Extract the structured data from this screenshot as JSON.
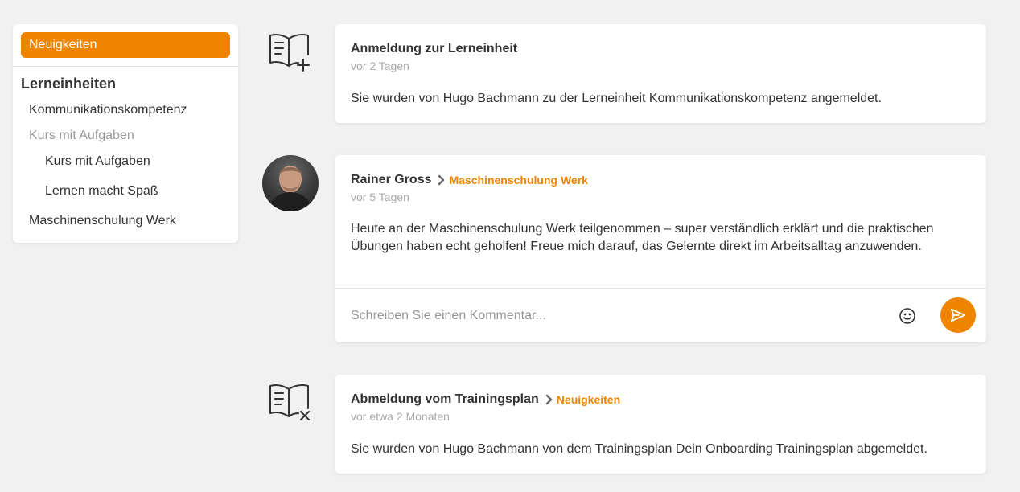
{
  "sidebar": {
    "active_label": "Neuigkeiten",
    "heading": "Lerneinheiten",
    "items": [
      {
        "label": "Kommunikationskompetenz"
      },
      {
        "label": "Kurs mit Aufgaben"
      },
      {
        "label": "Kurs mit Aufgaben"
      },
      {
        "label": "Lernen macht Spaß"
      },
      {
        "label": "Maschinenschulung Werk"
      }
    ]
  },
  "feed": [
    {
      "icon": "book-plus-icon",
      "title": "Anmeldung zur Lerneinheit",
      "time": "vor 2 Tagen",
      "body": "Sie wurden von Hugo Bachmann zu der Lerneinheit Kommunikationskompetenz angemeldet."
    },
    {
      "icon": "avatar",
      "author": "Rainer Gross",
      "breadcrumb": "Maschinenschulung Werk",
      "time": "vor 5 Tagen",
      "body": "Heute an der Maschinenschulung Werk teilgenommen – super verständlich erklärt und die praktischen Übungen haben echt geholfen! Freue mich darauf, das Gelernte direkt im Arbeitsalltag anzuwenden.",
      "comment_placeholder": "Schreiben Sie einen Kommentar..."
    },
    {
      "icon": "book-x-icon",
      "title": "Abmeldung vom Trainingsplan",
      "breadcrumb": "Neuigkeiten",
      "time": "vor etwa 2 Monaten",
      "body": "Sie wurden von Hugo Bachmann von dem Trainingsplan Dein Onboarding Trainingsplan abgemeldet."
    }
  ],
  "colors": {
    "accent": "#ef8400",
    "background": "#f1f1f1",
    "card": "#ffffff",
    "muted_text": "#aaaaaa"
  }
}
